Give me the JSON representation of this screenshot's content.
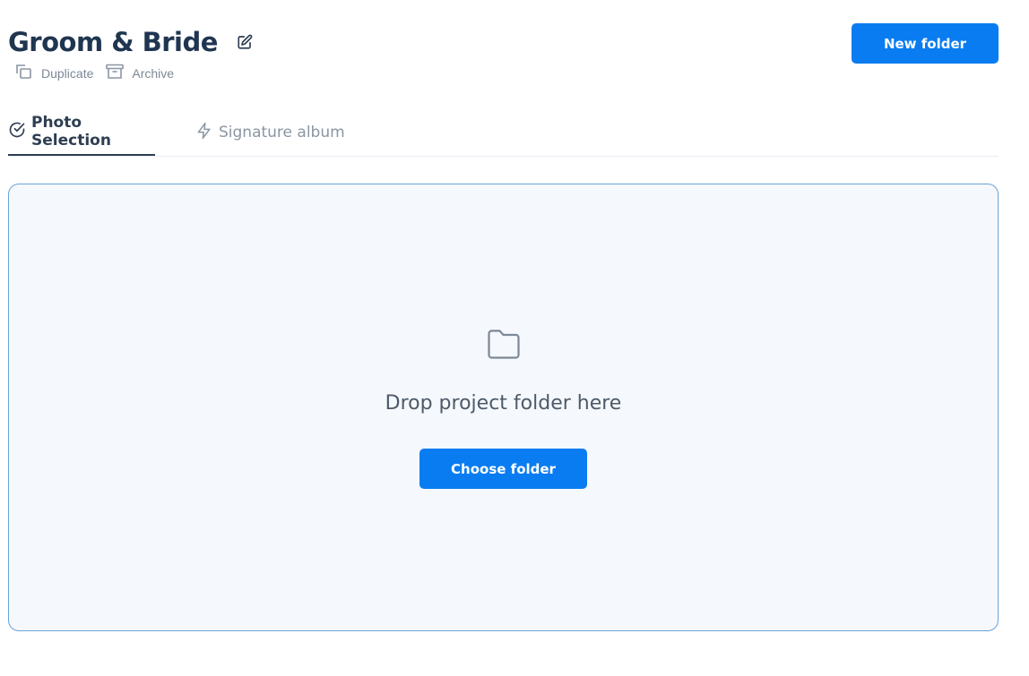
{
  "header": {
    "title": "Groom & Bride",
    "actions": [
      {
        "label": "Duplicate",
        "icon": "duplicate-icon"
      },
      {
        "label": "Archive",
        "icon": "archive-icon"
      }
    ],
    "new_folder_label": "New folder"
  },
  "tabs": [
    {
      "label": "Photo Selection",
      "icon": "check-circle-icon",
      "active": true
    },
    {
      "label": "Signature album",
      "icon": "lightning-icon",
      "active": false
    }
  ],
  "dropzone": {
    "icon": "folder-icon",
    "text": "Drop project folder here",
    "button_label": "Choose folder"
  },
  "colors": {
    "primary": "#0a7cf1",
    "title": "#1f3550",
    "muted": "#7d8896",
    "dropzone_bg": "#f5f8fc",
    "dropzone_border": "#6aa3d6"
  }
}
